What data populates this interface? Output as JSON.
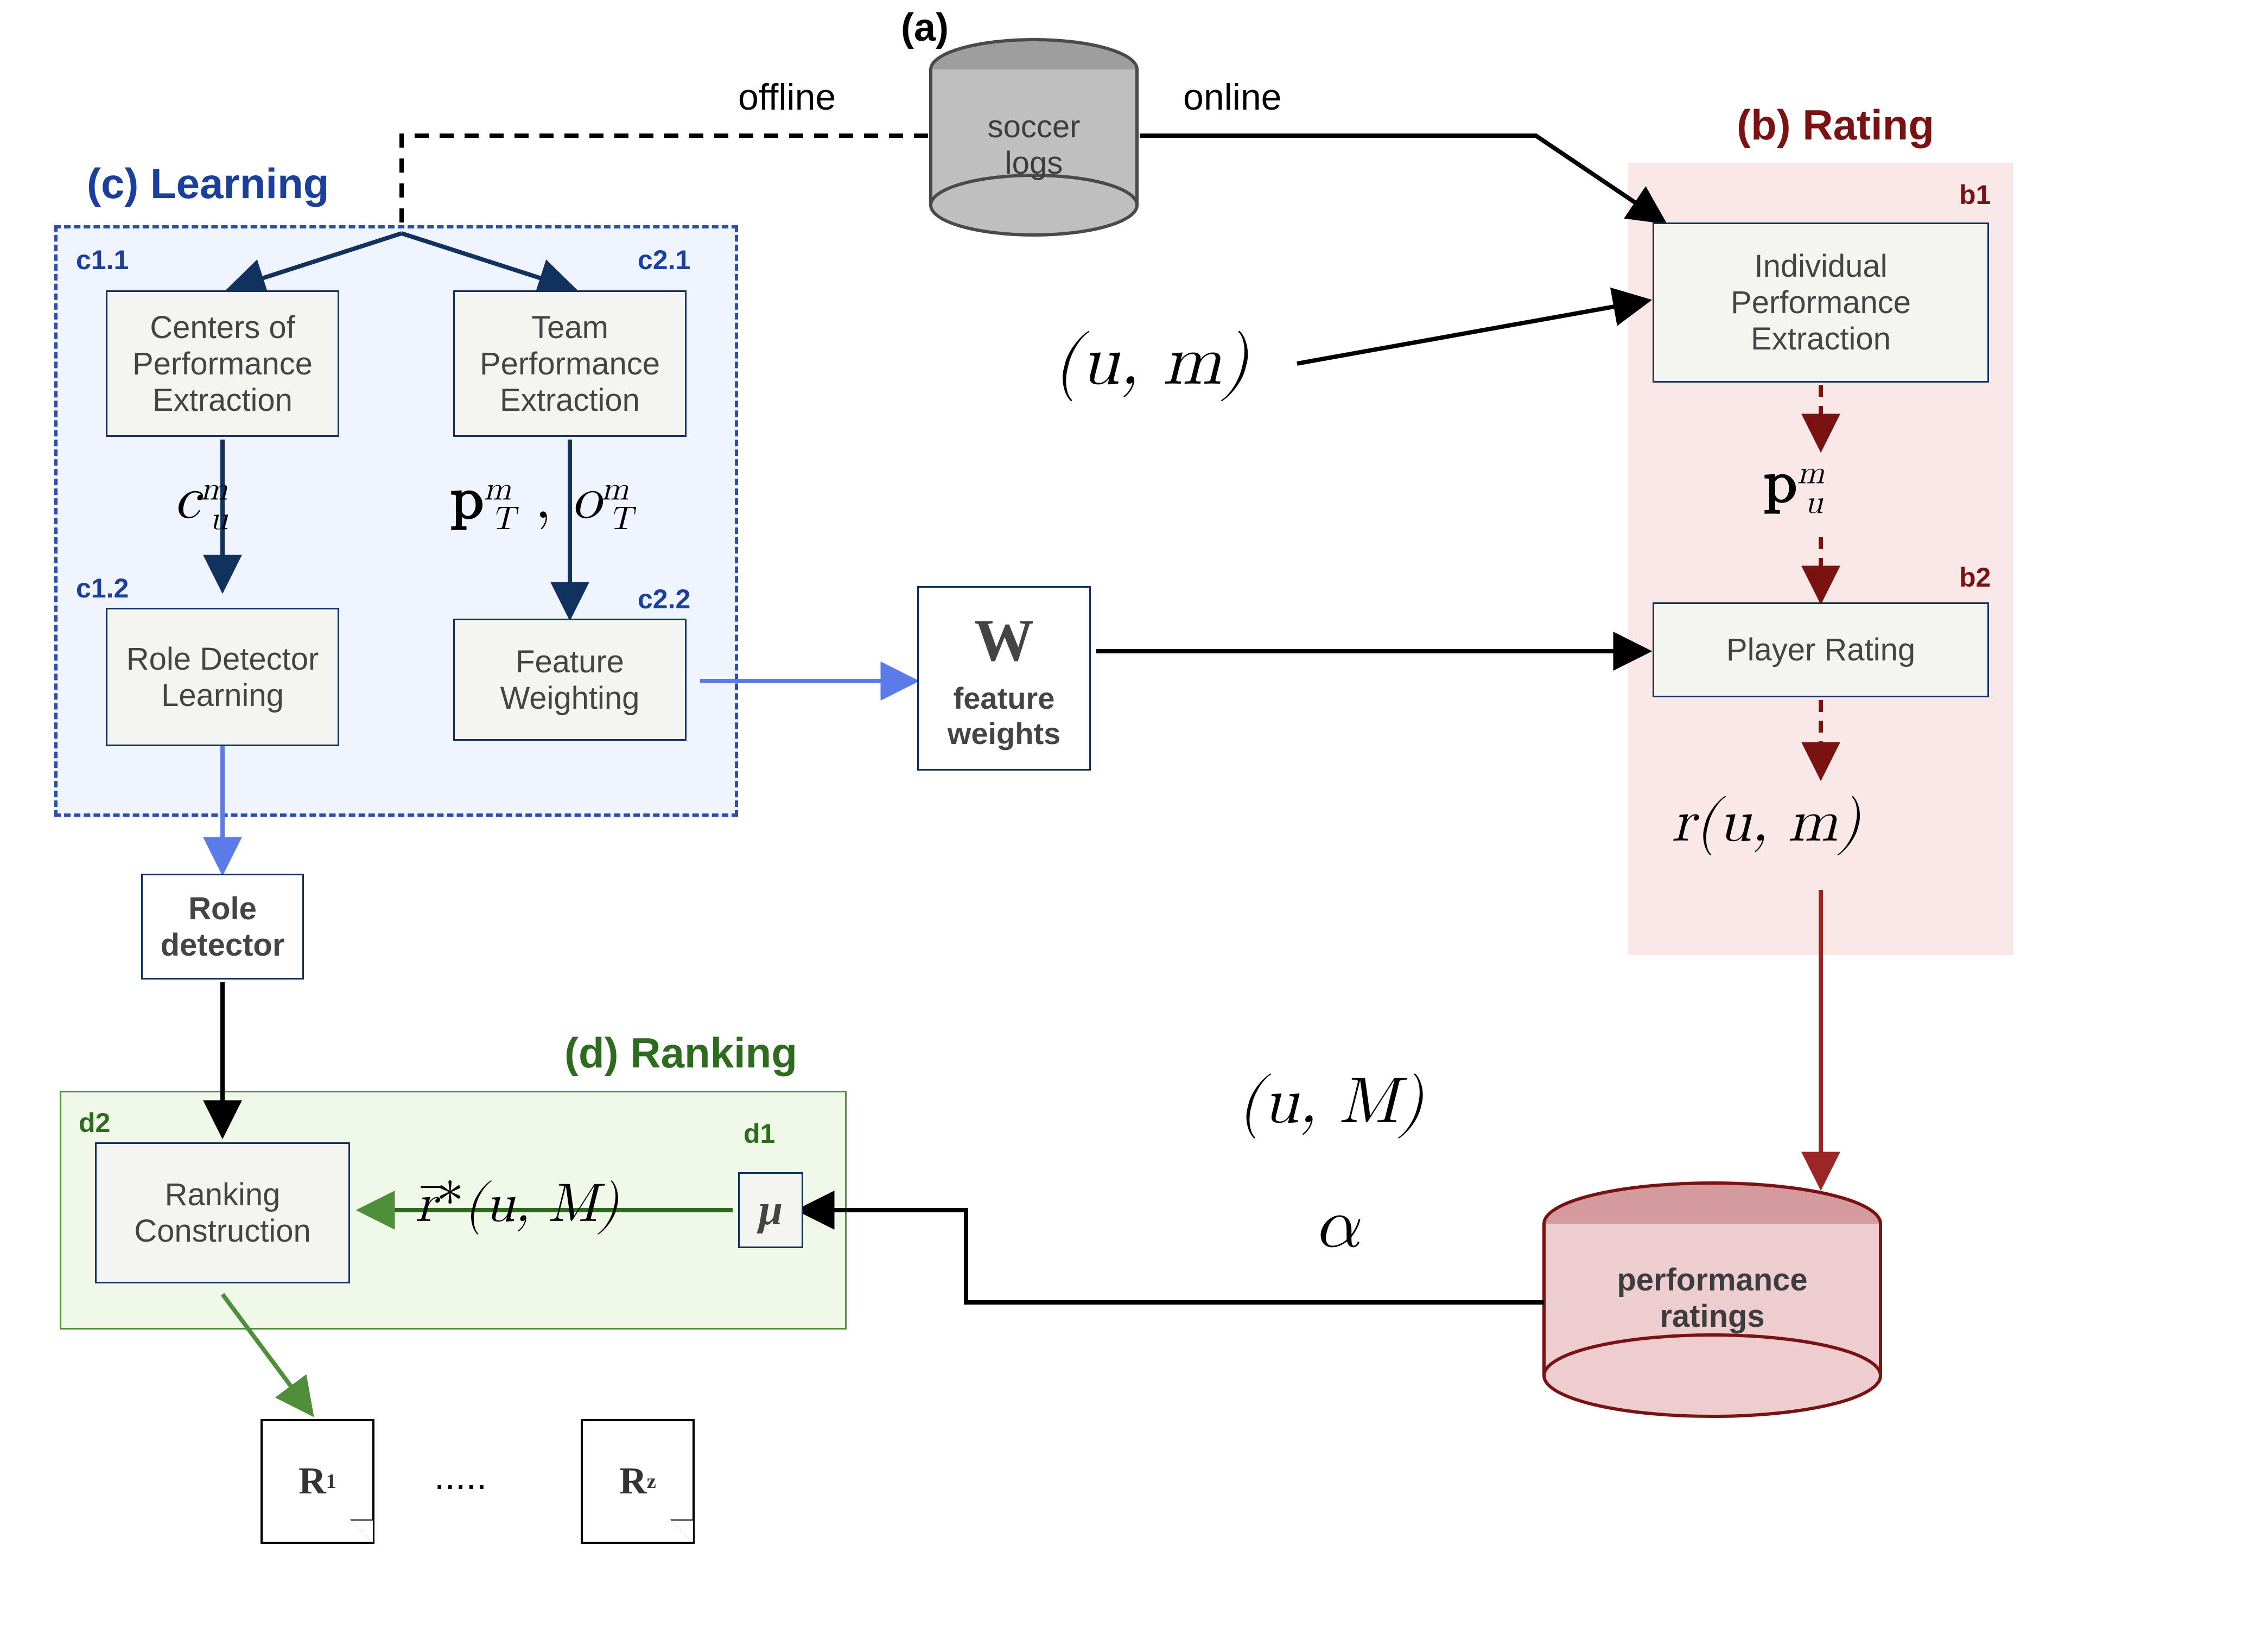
{
  "labels": {
    "a": "(a)",
    "offline": "offline",
    "online": "online",
    "soccer_logs": "soccer\nlogs",
    "perf_ratings": "performance\nratings",
    "feature_weights": "feature\nweights"
  },
  "sections": {
    "b": {
      "title": "(b) Rating"
    },
    "c": {
      "title": "(c) Learning"
    },
    "d": {
      "title": "(d) Ranking"
    }
  },
  "nodes": {
    "b1": {
      "tag": "b1",
      "label": "Individual Performance Extraction"
    },
    "b2": {
      "tag": "b2",
      "label": "Player Rating"
    },
    "c11": {
      "tag": "c1.1",
      "label": "Centers of Performance Extraction"
    },
    "c12": {
      "tag": "c1.2",
      "label": "Role Detector Learning"
    },
    "c21": {
      "tag": "c2.1",
      "label": "Team Performance Extraction"
    },
    "c22": {
      "tag": "c2.2",
      "label": "Feature Weighting"
    },
    "role_detector": "Role\ndetector",
    "W": "W",
    "d1": {
      "tag": "d1",
      "label": "μ"
    },
    "d2": {
      "tag": "d2",
      "label": "Ranking Construction"
    }
  },
  "math": {
    "um": "(u, m)",
    "p_um": "p_u^m",
    "r_um": "r(u, m)",
    "uM": "(u, M)",
    "alpha": "α",
    "rbar": "r̄*(u, M)",
    "c_um": "c_u^m",
    "pT_oT": "p_T^m , o_T^m"
  },
  "outputs": {
    "ellipsis": ".....",
    "r1": "R_1",
    "rz": "R_z"
  },
  "colors": {
    "navy": "#11315f",
    "blue": "#5b7be8",
    "red": "#9c2626",
    "darkred": "#7a1212",
    "green": "#4f8f3a",
    "gray": "#9e9e9e"
  }
}
